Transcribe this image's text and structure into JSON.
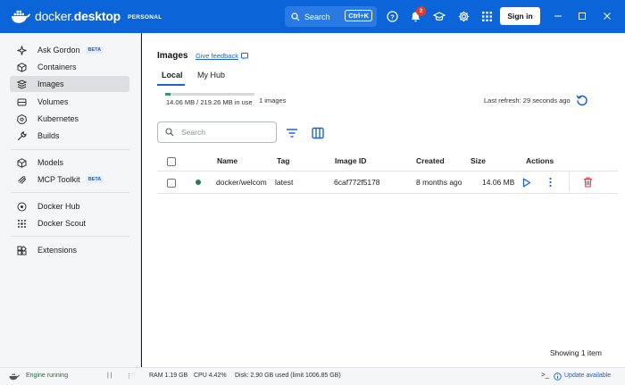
{
  "brand": {
    "name_light": "docker.",
    "name_bold": "desktop",
    "plan": "PERSONAL"
  },
  "titlebar": {
    "search_label": "Search",
    "search_shortcut": "Ctrl+K",
    "notification_count": "2",
    "signin_label": "Sign in"
  },
  "sidebar": {
    "items": [
      {
        "label": "Ask Gordon",
        "badge": "BETA",
        "icon": "sparkle-icon"
      },
      {
        "label": "Containers",
        "icon": "containers-icon"
      },
      {
        "label": "Images",
        "icon": "images-icon",
        "active": true
      },
      {
        "label": "Volumes",
        "icon": "volumes-icon"
      },
      {
        "label": "Kubernetes",
        "icon": "kubernetes-icon"
      },
      {
        "label": "Builds",
        "icon": "builds-icon"
      },
      {
        "label": "Models",
        "icon": "models-icon"
      },
      {
        "label": "MCP Toolkit",
        "badge": "BETA",
        "icon": "mcp-icon"
      },
      {
        "label": "Docker Hub",
        "icon": "hub-icon"
      },
      {
        "label": "Docker Scout",
        "icon": "scout-icon"
      },
      {
        "label": "Extensions",
        "icon": "extensions-icon"
      }
    ]
  },
  "main": {
    "title": "Images",
    "feedback_link": "Give feedback",
    "tabs": [
      {
        "label": "Local",
        "active": true
      },
      {
        "label": "My Hub"
      }
    ],
    "usage": {
      "text": "14.06 MB / 219.26 MB in use",
      "count": "1 images",
      "fraction": 0.064
    },
    "last_refresh": "Last refresh: 29 seconds ago",
    "search_placeholder": "Search",
    "table": {
      "headers": {
        "name": "Name",
        "tag": "Tag",
        "image_id": "Image ID",
        "created": "Created",
        "size": "Size",
        "actions": "Actions"
      },
      "rows": [
        {
          "name": "docker/welcom",
          "tag": "latest",
          "image_id": "6caf772f5178",
          "created": "8 months ago",
          "size": "14.06 MB",
          "status_color": "#2d7a4f"
        }
      ]
    },
    "showing": "Showing 1 item"
  },
  "statusbar": {
    "engine": "Engine running",
    "ram": "RAM 1.19 GB",
    "cpu": "CPU 4.42%",
    "disk": "Disk: 2.90 GB used (limit 1006.85 GB)",
    "update": "Update available"
  },
  "colors": {
    "accent": "#0b65d8",
    "link": "#1d63ce",
    "danger": "#d9363e",
    "running": "#2d7a4f"
  }
}
